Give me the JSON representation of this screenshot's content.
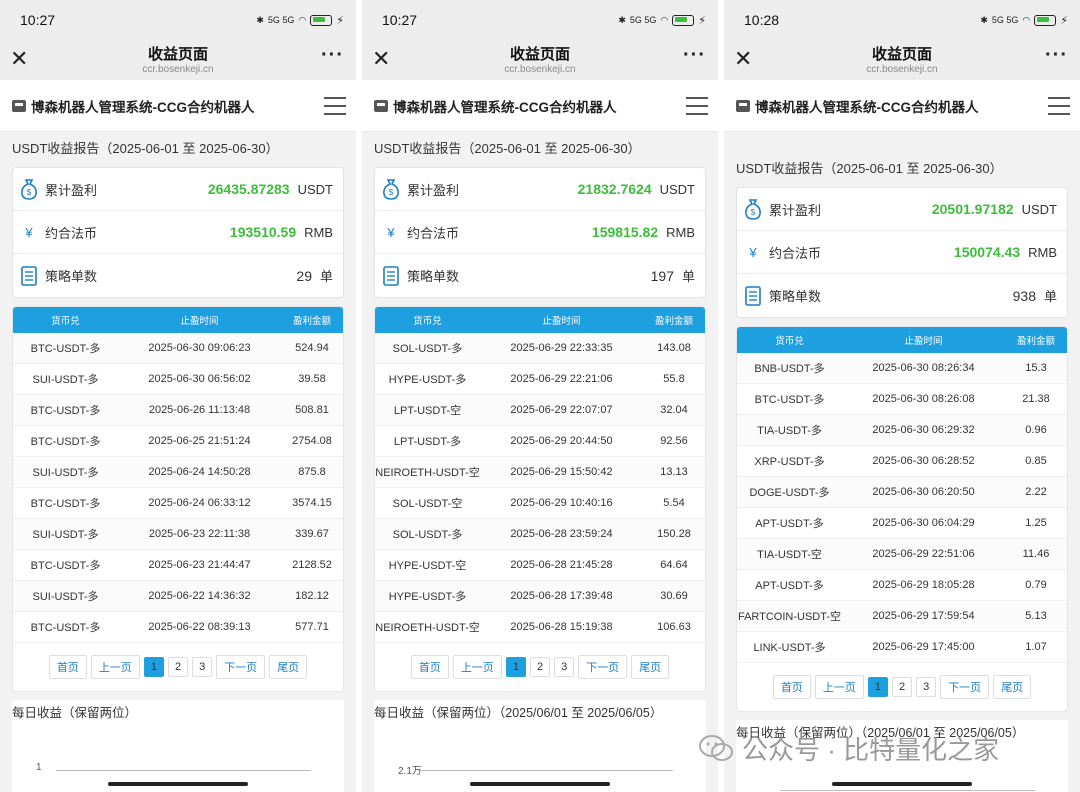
{
  "common": {
    "nav_title": "收益页面",
    "nav_url": "ccr.bosenkeji.cn",
    "app_title": "博森机器人管理系统-CCG合约机器人",
    "report_title": "USDT收益报告（2025-06-01 至 2025-06-30）",
    "labels": {
      "profit": "累计盈利",
      "fiat": "约合法币",
      "orders": "策略单数"
    },
    "units": {
      "usdt": "USDT",
      "rmb": "RMB",
      "dan": "单"
    },
    "headers": {
      "pair": "货币兑",
      "time": "止盈时间",
      "amount": "盈利金额"
    },
    "pager": {
      "first": "首页",
      "prev": "上一页",
      "p1": "1",
      "p2": "2",
      "p3": "3",
      "next": "下一页",
      "last": "尾页"
    },
    "status_icons": "5G 5G",
    "battery": "80"
  },
  "panels": [
    {
      "time": "10:27",
      "profit": "26435.87283",
      "fiat": "193510.59",
      "orders": "29",
      "daily_title": "每日收益（保留两位）",
      "axis_label": "1",
      "rows": [
        [
          "BTC-USDT-多",
          "2025-06-30 09:06:23",
          "524.94"
        ],
        [
          "SUI-USDT-多",
          "2025-06-30 06:56:02",
          "39.58"
        ],
        [
          "BTC-USDT-多",
          "2025-06-26 11:13:48",
          "508.81"
        ],
        [
          "BTC-USDT-多",
          "2025-06-25 21:51:24",
          "2754.08"
        ],
        [
          "SUI-USDT-多",
          "2025-06-24 14:50:28",
          "875.8"
        ],
        [
          "BTC-USDT-多",
          "2025-06-24 06:33:12",
          "3574.15"
        ],
        [
          "SUI-USDT-多",
          "2025-06-23 22:11:38",
          "339.67"
        ],
        [
          "BTC-USDT-多",
          "2025-06-23 21:44:47",
          "2128.52"
        ],
        [
          "SUI-USDT-多",
          "2025-06-22 14:36:32",
          "182.12"
        ],
        [
          "BTC-USDT-多",
          "2025-06-22 08:39:13",
          "577.71"
        ]
      ]
    },
    {
      "time": "10:27",
      "profit": "21832.7624",
      "fiat": "159815.82",
      "orders": "197",
      "daily_title": "每日收益（保留两位）（2025/06/01 至 2025/06/05）",
      "axis_label": "2.1万",
      "rows": [
        [
          "SOL-USDT-多",
          "2025-06-29 22:33:35",
          "143.08"
        ],
        [
          "HYPE-USDT-多",
          "2025-06-29 22:21:06",
          "55.8"
        ],
        [
          "LPT-USDT-空",
          "2025-06-29 22:07:07",
          "32.04"
        ],
        [
          "LPT-USDT-多",
          "2025-06-29 20:44:50",
          "92.56"
        ],
        [
          "NEIROETH-USDT-空",
          "2025-06-29 15:50:42",
          "13.13"
        ],
        [
          "SOL-USDT-空",
          "2025-06-29 10:40:16",
          "5.54"
        ],
        [
          "SOL-USDT-多",
          "2025-06-28 23:59:24",
          "150.28"
        ],
        [
          "HYPE-USDT-空",
          "2025-06-28 21:45:28",
          "64.64"
        ],
        [
          "HYPE-USDT-多",
          "2025-06-28 17:39:48",
          "30.69"
        ],
        [
          "NEIROETH-USDT-空",
          "2025-06-28 15:19:38",
          "106.63"
        ]
      ]
    },
    {
      "time": "10:28",
      "profit": "20501.97182",
      "fiat": "150074.43",
      "orders": "938",
      "daily_title": "每日收益（保留两位）（2025/06/01 至 2025/06/05）",
      "axis_label": "",
      "rows": [
        [
          "BNB-USDT-多",
          "2025-06-30 08:26:34",
          "15.3"
        ],
        [
          "BTC-USDT-多",
          "2025-06-30 08:26:08",
          "21.38"
        ],
        [
          "TIA-USDT-多",
          "2025-06-30 06:29:32",
          "0.96"
        ],
        [
          "XRP-USDT-多",
          "2025-06-30 06:28:52",
          "0.85"
        ],
        [
          "DOGE-USDT-多",
          "2025-06-30 06:20:50",
          "2.22"
        ],
        [
          "APT-USDT-多",
          "2025-06-30 06:04:29",
          "1.25"
        ],
        [
          "TIA-USDT-空",
          "2025-06-29 22:51:06",
          "11.46"
        ],
        [
          "APT-USDT-多",
          "2025-06-29 18:05:28",
          "0.79"
        ],
        [
          "FARTCOIN-USDT-空",
          "2025-06-29 17:59:54",
          "5.13"
        ],
        [
          "LINK-USDT-多",
          "2025-06-29 17:45:00",
          "1.07"
        ]
      ]
    }
  ],
  "watermark": {
    "text": "公众号 · 比特量化之家"
  },
  "colors": {
    "accent": "#1d9fe0",
    "profit_green": "#3cbd3c",
    "bar_bg": "#ededed"
  },
  "icons": {
    "close": "close-icon",
    "more": "more-icon",
    "menu": "menu-icon",
    "money_bag": "money-bag-icon",
    "yen": "yen-icon",
    "document": "document-icon"
  }
}
